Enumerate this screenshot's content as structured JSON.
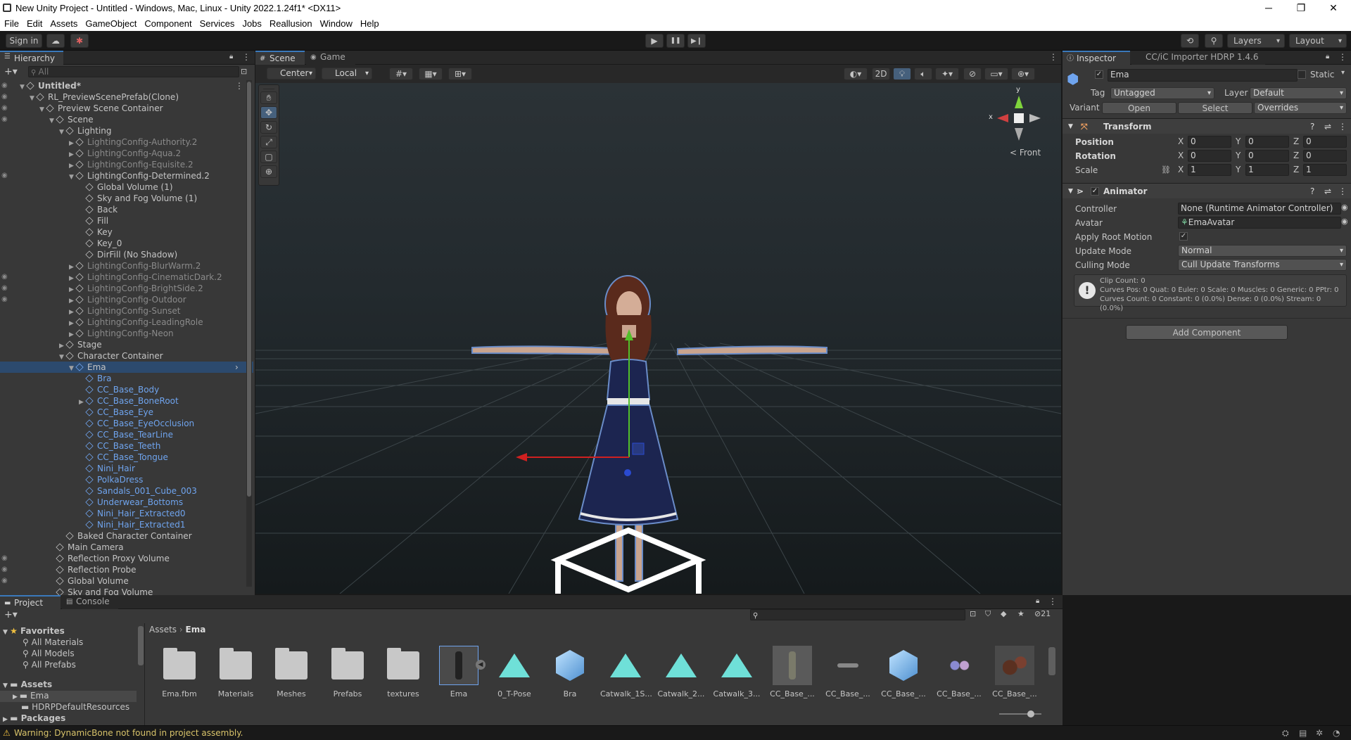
{
  "window": {
    "title": "New Unity Project - Untitled - Windows, Mac, Linux - Unity 2022.1.24f1* <DX11>",
    "min": "─",
    "max": "❐",
    "close": "✕"
  },
  "menu": [
    "File",
    "Edit",
    "Assets",
    "GameObject",
    "Component",
    "Services",
    "Jobs",
    "Reallusion",
    "Window",
    "Help"
  ],
  "toolbar": {
    "sign_in": "Sign in",
    "layers": "Layers",
    "layout": "Layout",
    "play": "▶",
    "pause": "❚❚",
    "step": "▶❙"
  },
  "hierarchy": {
    "tab": "Hierarchy",
    "search_placeholder": "All",
    "rows": [
      {
        "label": "Untitled*",
        "indent": 0,
        "arrow": "▼",
        "style": "scene"
      },
      {
        "label": "RL_PreviewScenePrefab(Clone)",
        "indent": 1,
        "arrow": "▼",
        "style": ""
      },
      {
        "label": "Preview Scene Container",
        "indent": 2,
        "arrow": "▼",
        "style": ""
      },
      {
        "label": "Scene",
        "indent": 3,
        "arrow": "▼",
        "style": ""
      },
      {
        "label": "Lighting",
        "indent": 4,
        "arrow": "▼",
        "style": ""
      },
      {
        "label": "LightingConfig-Authority.2",
        "indent": 5,
        "arrow": "▶",
        "style": "dim"
      },
      {
        "label": "LightingConfig-Aqua.2",
        "indent": 5,
        "arrow": "▶",
        "style": "dim"
      },
      {
        "label": "LightingConfig-Equisite.2",
        "indent": 5,
        "arrow": "▶",
        "style": "dim"
      },
      {
        "label": "LightingConfig-Determined.2",
        "indent": 5,
        "arrow": "▼",
        "style": ""
      },
      {
        "label": "Global Volume (1)",
        "indent": 6,
        "arrow": "",
        "style": ""
      },
      {
        "label": "Sky and Fog Volume (1)",
        "indent": 6,
        "arrow": "",
        "style": ""
      },
      {
        "label": "Back",
        "indent": 6,
        "arrow": "",
        "style": ""
      },
      {
        "label": "Fill",
        "indent": 6,
        "arrow": "",
        "style": ""
      },
      {
        "label": "Key",
        "indent": 6,
        "arrow": "",
        "style": ""
      },
      {
        "label": "Key_0",
        "indent": 6,
        "arrow": "",
        "style": ""
      },
      {
        "label": "DirFill (No Shadow)",
        "indent": 6,
        "arrow": "",
        "style": ""
      },
      {
        "label": "LightingConfig-BlurWarm.2",
        "indent": 5,
        "arrow": "▶",
        "style": "dim"
      },
      {
        "label": "LightingConfig-CinematicDark.2",
        "indent": 5,
        "arrow": "▶",
        "style": "dim"
      },
      {
        "label": "LightingConfig-BrightSide.2",
        "indent": 5,
        "arrow": "▶",
        "style": "dim"
      },
      {
        "label": "LightingConfig-Outdoor",
        "indent": 5,
        "arrow": "▶",
        "style": "dim"
      },
      {
        "label": "LightingConfig-Sunset",
        "indent": 5,
        "arrow": "▶",
        "style": "dim"
      },
      {
        "label": "LightingConfig-LeadingRole",
        "indent": 5,
        "arrow": "▶",
        "style": "dim"
      },
      {
        "label": "LightingConfig-Neon",
        "indent": 5,
        "arrow": "▶",
        "style": "dim"
      },
      {
        "label": "Stage",
        "indent": 4,
        "arrow": "▶",
        "style": ""
      },
      {
        "label": "Character Container",
        "indent": 4,
        "arrow": "▼",
        "style": ""
      },
      {
        "label": "Ema",
        "indent": 5,
        "arrow": "▼",
        "style": "sel"
      },
      {
        "label": "Bra",
        "indent": 6,
        "arrow": "",
        "style": "blue"
      },
      {
        "label": "CC_Base_Body",
        "indent": 6,
        "arrow": "",
        "style": "blue"
      },
      {
        "label": "CC_Base_BoneRoot",
        "indent": 6,
        "arrow": "▶",
        "style": "blue"
      },
      {
        "label": "CC_Base_Eye",
        "indent": 6,
        "arrow": "",
        "style": "blue"
      },
      {
        "label": "CC_Base_EyeOcclusion",
        "indent": 6,
        "arrow": "",
        "style": "blue"
      },
      {
        "label": "CC_Base_TearLine",
        "indent": 6,
        "arrow": "",
        "style": "blue"
      },
      {
        "label": "CC_Base_Teeth",
        "indent": 6,
        "arrow": "",
        "style": "blue"
      },
      {
        "label": "CC_Base_Tongue",
        "indent": 6,
        "arrow": "",
        "style": "blue"
      },
      {
        "label": "Nini_Hair",
        "indent": 6,
        "arrow": "",
        "style": "blue"
      },
      {
        "label": "PolkaDress",
        "indent": 6,
        "arrow": "",
        "style": "blue"
      },
      {
        "label": "Sandals_001_Cube_003",
        "indent": 6,
        "arrow": "",
        "style": "blue"
      },
      {
        "label": "Underwear_Bottoms",
        "indent": 6,
        "arrow": "",
        "style": "blue"
      },
      {
        "label": "Nini_Hair_Extracted0",
        "indent": 6,
        "arrow": "",
        "style": "blue"
      },
      {
        "label": "Nini_Hair_Extracted1",
        "indent": 6,
        "arrow": "",
        "style": "blue"
      },
      {
        "label": "Baked Character Container",
        "indent": 4,
        "arrow": "",
        "style": ""
      },
      {
        "label": "Main Camera",
        "indent": 3,
        "arrow": "",
        "style": ""
      },
      {
        "label": "Reflection Proxy Volume",
        "indent": 3,
        "arrow": "",
        "style": ""
      },
      {
        "label": "Reflection Probe",
        "indent": 3,
        "arrow": "",
        "style": ""
      },
      {
        "label": "Global Volume",
        "indent": 3,
        "arrow": "",
        "style": ""
      },
      {
        "label": "Sky and Fog Volume",
        "indent": 3,
        "arrow": "",
        "style": ""
      }
    ]
  },
  "scene": {
    "tab_scene": "Scene",
    "tab_game": "Game",
    "pivot": "Center",
    "space": "Local",
    "twod": "2D",
    "gizmo_front": "Front",
    "gizmo_x": "x",
    "gizmo_y": "y"
  },
  "inspector": {
    "tab": "Inspector",
    "tab2": "CC/iC Importer HDRP 1.4.6",
    "object_name": "Ema",
    "static_label": "Static",
    "tag_label": "Tag",
    "tag_value": "Untagged",
    "layer_label": "Layer",
    "layer_value": "Default",
    "variant_label": "Variant",
    "open": "Open",
    "select": "Select",
    "overrides": "Overrides",
    "transform": {
      "title": "Transform",
      "position": "Position",
      "rotation": "Rotation",
      "scale": "Scale",
      "pos": [
        "0",
        "0",
        "0"
      ],
      "rot": [
        "0",
        "0",
        "0"
      ],
      "scl": [
        "1",
        "1",
        "1"
      ],
      "x": "X",
      "y": "Y",
      "z": "Z"
    },
    "animator": {
      "title": "Animator",
      "controller_label": "Controller",
      "controller_value": "None (Runtime Animator Controller)",
      "avatar_label": "Avatar",
      "avatar_value": "EmaAvatar",
      "apply_root_label": "Apply Root Motion",
      "update_label": "Update Mode",
      "update_value": "Normal",
      "culling_label": "Culling Mode",
      "culling_value": "Cull Update Transforms",
      "info1": "Clip Count: 0",
      "info2": "Curves Pos: 0 Quat: 0 Euler: 0 Scale: 0 Muscles: 0 Generic: 0 PPtr: 0",
      "info3": "Curves Count: 0 Constant: 0 (0.0%) Dense: 0 (0.0%) Stream: 0 (0.0%)"
    },
    "add_component": "Add Component"
  },
  "project": {
    "tab_project": "Project",
    "tab_console": "Console",
    "favorites": "Favorites",
    "fav_items": [
      "All Materials",
      "All Models",
      "All Prefabs"
    ],
    "assets": "Assets",
    "ema": "Ema",
    "hdrp": "HDRPDefaultResources",
    "packages": "Packages",
    "crumb1": "Assets",
    "crumb2": "Ema",
    "count": "21",
    "items": [
      {
        "label": "Ema.fbm",
        "kind": "folder"
      },
      {
        "label": "Materials",
        "kind": "folder"
      },
      {
        "label": "Meshes",
        "kind": "folder"
      },
      {
        "label": "Prefabs",
        "kind": "folder"
      },
      {
        "label": "textures",
        "kind": "folder"
      },
      {
        "label": "Ema",
        "kind": "model"
      },
      {
        "label": "0_T-Pose",
        "kind": "anim"
      },
      {
        "label": "Bra",
        "kind": "mesh"
      },
      {
        "label": "Catwalk_1S...",
        "kind": "anim"
      },
      {
        "label": "Catwalk_2...",
        "kind": "anim"
      },
      {
        "label": "Catwalk_3...",
        "kind": "anim"
      },
      {
        "label": "CC_Base_...",
        "kind": "figure"
      },
      {
        "label": "CC_Base_...",
        "kind": "eyes"
      },
      {
        "label": "CC_Base_...",
        "kind": "mesh"
      },
      {
        "label": "CC_Base_...",
        "kind": "spheres"
      },
      {
        "label": "CC_Base_...",
        "kind": "spheres2"
      }
    ]
  },
  "status": {
    "warning": "Warning: DynamicBone not found in project assembly."
  }
}
